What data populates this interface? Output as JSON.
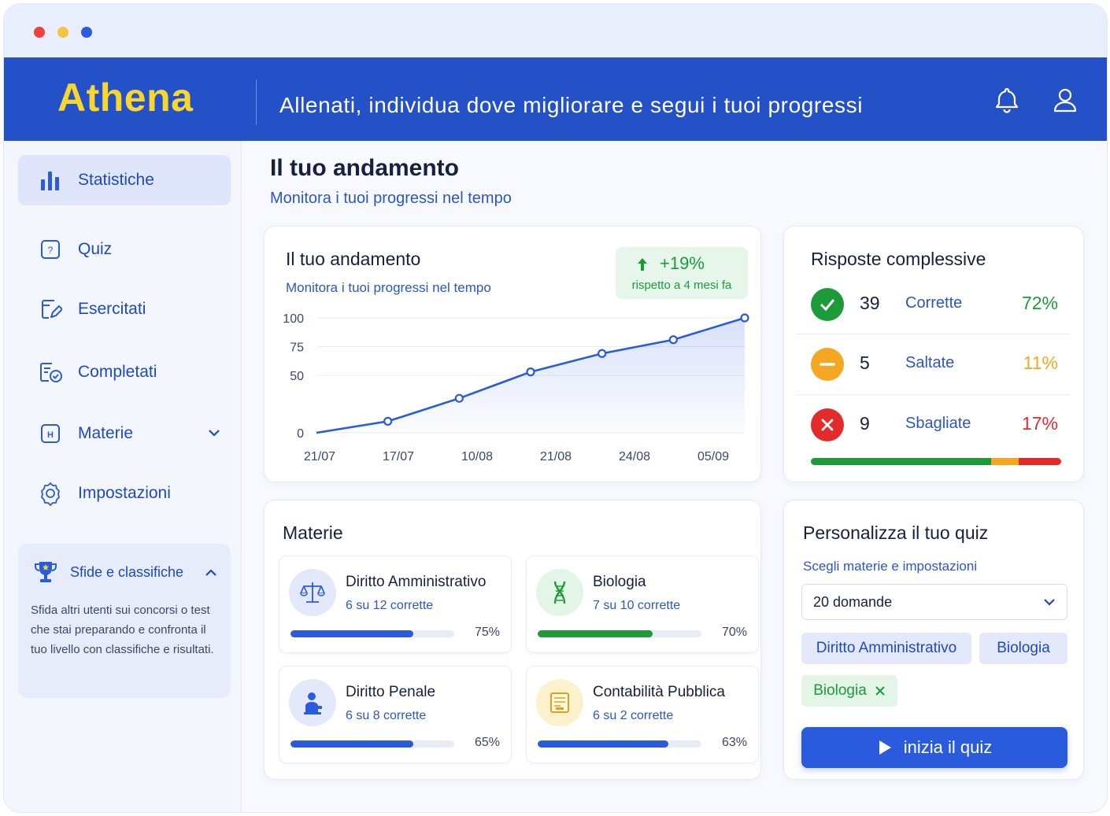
{
  "app": {
    "name": "Athena",
    "tagline": "Allenati, individua dove migliorare e segui i tuoi progressi"
  },
  "colors": {
    "brand": "#2451c7",
    "logo": "#f9d62e",
    "accent": "#2a5bdc",
    "success": "#1d9b3b",
    "warning": "#f5a623",
    "danger": "#e42b2b"
  },
  "sidebar": {
    "items": [
      {
        "label": "Statistiche",
        "icon": "bar-chart-icon",
        "active": true
      },
      {
        "label": "Quiz",
        "icon": "quiz-icon"
      },
      {
        "label": "Esercitati",
        "icon": "practice-icon"
      },
      {
        "label": "Completati",
        "icon": "completed-icon"
      },
      {
        "label": "Materie",
        "icon": "subjects-icon",
        "expandable": true
      },
      {
        "label": "Impostazioni",
        "icon": "gear-icon"
      }
    ],
    "challenge": {
      "title": "Sfide e classifiche",
      "text": "Sfida altri utenti sui concorsi o test che stai preparando e confronta il tuo livello con classifiche e risultati."
    }
  },
  "main": {
    "title": "Il tuo andamento",
    "subtitle": "Monitora i tuoi progressi nel tempo"
  },
  "progress_card": {
    "title": "Il tuo andamento",
    "subtitle": "Monitora i tuoi progressi nel tempo",
    "change": "+19%",
    "change_caption": "rispetto a 4 mesi fa"
  },
  "chart_data": {
    "type": "area",
    "x": [
      "21/07",
      "17/07",
      "10/08",
      "21/08",
      "24/08",
      "05/09"
    ],
    "y_ticks": [
      0,
      50,
      75,
      100
    ],
    "points": [
      {
        "x": "21/07",
        "y": 0
      },
      {
        "x": "",
        "y": 10
      },
      {
        "x": "",
        "y": 30
      },
      {
        "x": "",
        "y": 53
      },
      {
        "x": "",
        "y": 69
      },
      {
        "x": "",
        "y": 81
      },
      {
        "x": "05/09",
        "y": 100
      }
    ],
    "grid": true,
    "line_color": "#2a5bdc"
  },
  "answers": {
    "title": "Risposte complessive",
    "rows": [
      {
        "count": "39",
        "label": "Corrette",
        "pct": "72%",
        "color": "#1d9b3b",
        "icon": "check-icon",
        "share": 0.72
      },
      {
        "count": "5",
        "label": "Saltate",
        "pct": "11%",
        "color": "#f5a623",
        "icon": "minus-icon",
        "share": 0.11
      },
      {
        "count": "9",
        "label": "Sbagliate",
        "pct": "17%",
        "color": "#e42b2b",
        "icon": "x-icon",
        "share": 0.17
      }
    ]
  },
  "subjects": {
    "title": "Materie",
    "items": [
      {
        "name": "Diritto Amministrativo",
        "score": "6 su 12 corrette",
        "pct": "75%",
        "progress": 0.75,
        "color": "#2a5bdc",
        "icon": "scales-icon"
      },
      {
        "name": "Biologia",
        "score": "7 su 10 corrette",
        "pct": "70%",
        "progress": 0.7,
        "color": "#1d9b3b",
        "icon": "dna-icon"
      },
      {
        "name": "Diritto Penale",
        "score": "6 su 8 corrette",
        "pct": "65%",
        "progress": 0.75,
        "color": "#2a5bdc",
        "icon": "judge-icon"
      },
      {
        "name": "Contabilità Pubblica",
        "score": "6 su 2 corrette",
        "pct": "63%",
        "progress": 0.8,
        "color": "#2a5bdc",
        "icon": "ledger-icon"
      }
    ]
  },
  "customize": {
    "title": "Personalizza il tuo quiz",
    "subtitle": "Scegli materie e impostazioni",
    "select_value": "20 domande",
    "chips": [
      "Diritto Amministrativo",
      "Biologia"
    ],
    "selected_chip": "Biologia",
    "start_label": "inizia il quiz"
  }
}
